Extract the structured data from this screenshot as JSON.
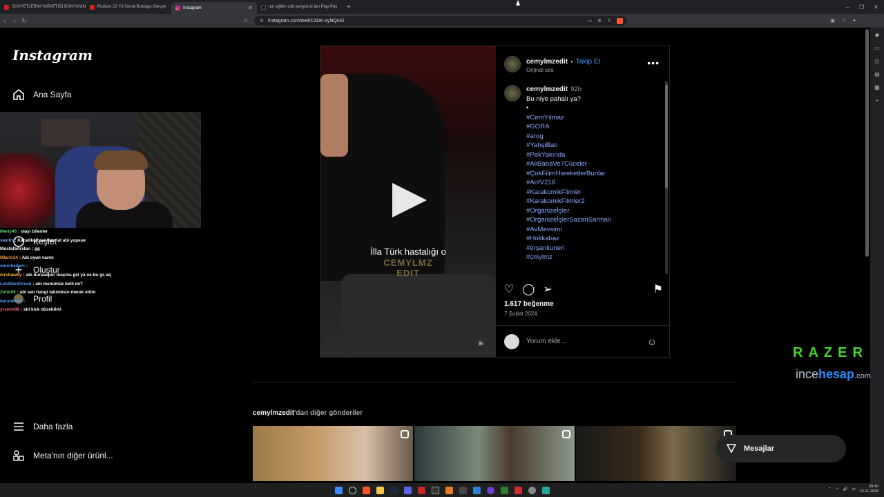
{
  "browser": {
    "tabs": [
      {
        "label": "SOVYETLERİN YARATTIĞI DÜNYANIN",
        "active": false
      },
      {
        "label": "Podium 22 Yıl Sonra Buldugu Gerçek",
        "active": false
      },
      {
        "label": "Instagram",
        "active": true
      },
      {
        "label": "ları eğitim çok seviyoruz ları Play Pay",
        "active": false
      }
    ],
    "new_tab": "+",
    "url": "instagram.com/reel/C3DK-syNQnS/"
  },
  "sidebar": {
    "logo": "Instagram",
    "home": "Ana Sayfa",
    "explore": "Keşfet",
    "create": "Oluştur",
    "profile": "Profil",
    "more": "Daha fazla",
    "meta": "Meta'nın diğer ürünl..."
  },
  "stream_chat": [
    {
      "user": "Merty46",
      "text": "olayı bilenler",
      "color": "#6cd36c"
    },
    {
      "user": "swnfrr",
      "text": "Kabalikçiccel hatırlat abi yupeue",
      "color": "#7fb2ff"
    },
    {
      "user": "MustafaArslan",
      "text": "gg",
      "color": "#ffffff"
    },
    {
      "user": "Mlarm14",
      "text": "Abi oyun varmı",
      "color": "#ff9a3c"
    },
    {
      "user": "omerkadam",
      "text": "",
      "color": "#4f9bff"
    },
    {
      "user": "mrshawby",
      "text": "abi bursaspor maçına gel ya ne bu gs aq",
      "color": "#ffb03c"
    },
    {
      "user": "LokiManElrean",
      "text": "abi menümüz belli mi?",
      "color": "#4f9bff"
    },
    {
      "user": "Zehir05",
      "text": "abi sen hangi takımlısın merak ettim",
      "color": "#6cd36c"
    },
    {
      "user": "barankaan",
      "text": "",
      "color": "#4f9bff"
    },
    {
      "user": "yrsenn06",
      "text": "abi kick düzeldimi",
      "color": "#ff6b6b"
    }
  ],
  "post": {
    "username": "cemylmzedit",
    "follow": "Takip Et",
    "audio": "Orijinal ses",
    "caption_user": "cemylmzedit",
    "caption_time": "92h",
    "caption_text": "Bu niye pahalı ya?",
    "bullet": "•",
    "hashtags": [
      "#CemYılmaz",
      "#GORA",
      "#arog",
      "#YahşiBatı",
      "#PekYakında",
      "#AliBabaVe7Cüceler",
      "#ÇokFilimHareketlerBunlar",
      "#ArifV216",
      "#KarakomikFilmler",
      "#KarakomikFilmler2",
      "#Organizeİşler",
      "#OrganizeİşlerSazanSarmalı",
      "#AvMevsimi",
      "#Hokkabaz",
      "#erşankuneri",
      "#cmylmz"
    ],
    "video_caption": "İlla Türk hastalığı o",
    "watermark_line1": "CEMYLMZ",
    "watermark_line2": "EDIT",
    "likes": "1.617 beğenme",
    "date": "7 Şubat 2024",
    "comment_placeholder": "Yorum ekle..."
  },
  "more_posts": {
    "user": "cemylmzedit",
    "suffix": "'dan diğer gönderiler"
  },
  "overlay": {
    "razer": "RAZER",
    "ince_1": "ince",
    "ince_2": "hesap",
    "ince_3": ".com"
  },
  "messages": "Mesajlar",
  "clock": {
    "time": "09:40",
    "date": "15.11.2025"
  },
  "colors": {
    "link": "#4a9cff",
    "hashtag": "#8aa8ff",
    "background": "#000000"
  }
}
